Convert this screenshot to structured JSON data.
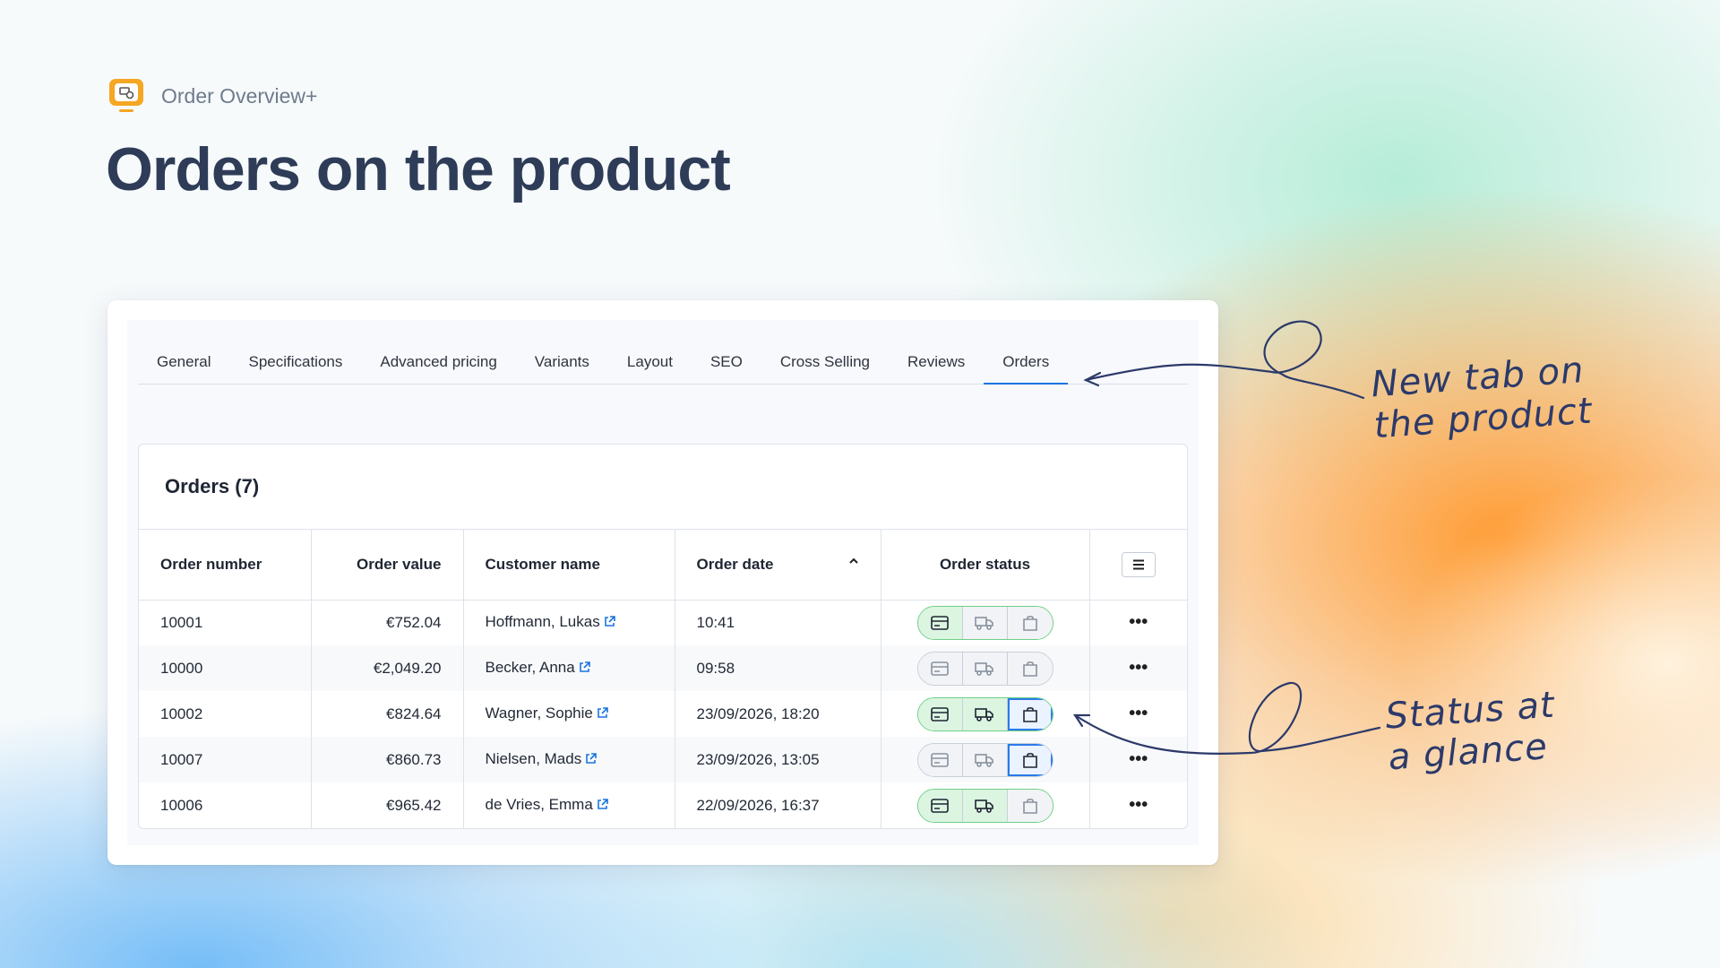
{
  "brand": {
    "name": "Order Overview+",
    "icon": "order-app-icon",
    "accent": "#f5a623"
  },
  "hero_title": "Orders on the product",
  "tabs": [
    {
      "label": "General",
      "active": false
    },
    {
      "label": "Specifications",
      "active": false
    },
    {
      "label": "Advanced pricing",
      "active": false
    },
    {
      "label": "Variants",
      "active": false
    },
    {
      "label": "Layout",
      "active": false
    },
    {
      "label": "SEO",
      "active": false
    },
    {
      "label": "Cross Selling",
      "active": false
    },
    {
      "label": "Reviews",
      "active": false
    },
    {
      "label": "Orders",
      "active": true
    }
  ],
  "orders_panel": {
    "title": "Orders (7)",
    "columns": {
      "order_number": "Order number",
      "order_value": "Order value",
      "customer_name": "Customer name",
      "order_date": "Order date",
      "order_status": "Order status"
    },
    "sort_indicator": "ascending",
    "rows": [
      {
        "number": "10001",
        "value": "€752.04",
        "customer": "Hoffmann, Lukas",
        "date": "10:41",
        "paid": true,
        "shipped": false,
        "delivered": false
      },
      {
        "number": "10000",
        "value": "€2,049.20",
        "customer": "Becker, Anna",
        "date": "09:58",
        "paid": false,
        "shipped": false,
        "delivered": false
      },
      {
        "number": "10002",
        "value": "€824.64",
        "customer": "Wagner, Sophie",
        "date": "23/09/2026, 18:20",
        "paid": true,
        "shipped": true,
        "delivered": true
      },
      {
        "number": "10007",
        "value": "€860.73",
        "customer": "Nielsen, Mads",
        "date": "23/09/2026, 13:05",
        "paid": false,
        "shipped": false,
        "delivered": true
      },
      {
        "number": "10006",
        "value": "€965.42",
        "customer": "de Vries, Emma",
        "date": "22/09/2026, 16:37",
        "paid": true,
        "shipped": true,
        "delivered": false
      }
    ],
    "row_actions_icon": "more-horizontal-icon"
  },
  "annotations": {
    "tab_note_line1": "New tab on",
    "tab_note_line2": "the product",
    "status_note_line1": "Status at",
    "status_note_line2": "a glance"
  },
  "colors": {
    "title": "#2e3c58",
    "active_tab": "#1a74e0",
    "status_green": "#dbf5e1",
    "status_blue": "#2a7bea",
    "annotation_ink": "#2c3a6a"
  }
}
